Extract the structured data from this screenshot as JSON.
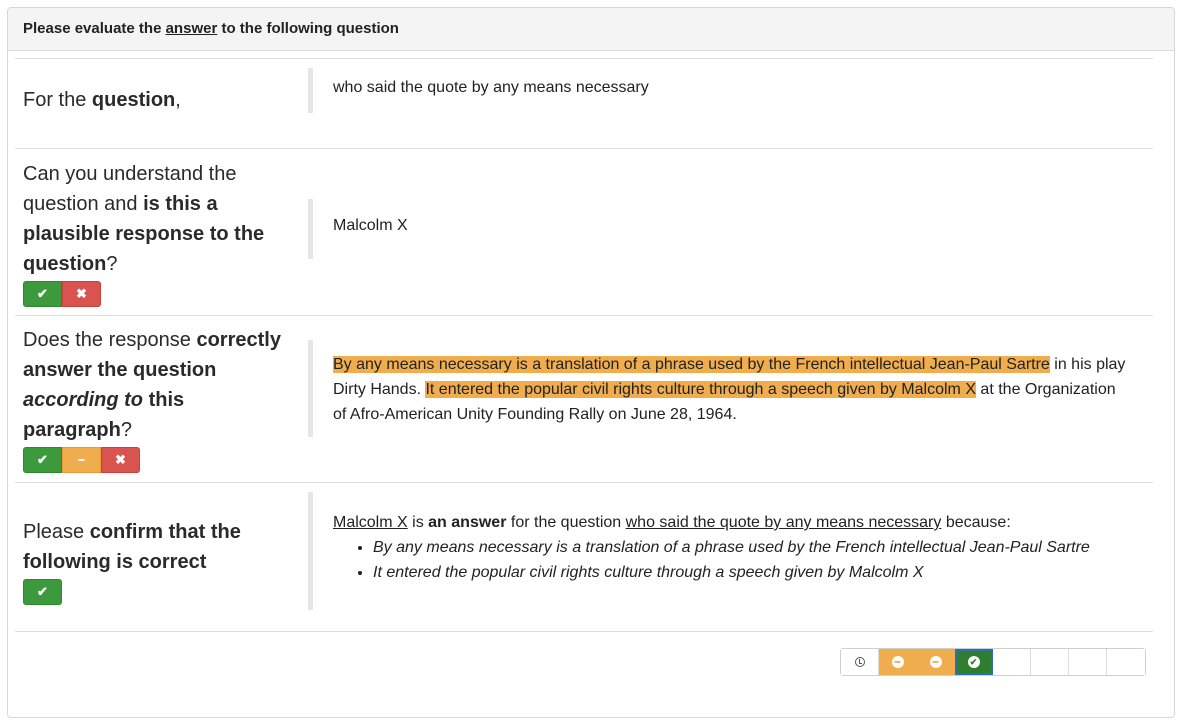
{
  "header": {
    "prefix": "Please evaluate the",
    "keyword": "answer",
    "suffix": "to the following question"
  },
  "rows": {
    "question": {
      "label_pre": "For the",
      "label_bold": "question",
      "label_post": ",",
      "value": "who said the quote by any means necessary"
    },
    "plausible": {
      "label_pre": "Can you understand the question and",
      "label_bold": "is this a plausible response to the question",
      "label_post": "?",
      "value": "Malcolm X",
      "buttons": [
        {
          "icon": "check-icon",
          "glyph": "✔",
          "color": "#3c9a3c"
        },
        {
          "icon": "cross-icon",
          "glyph": "✖",
          "color": "#d9534f"
        }
      ]
    },
    "correct": {
      "label_pre": "Does the response",
      "label_bold": "correctly answer the question",
      "label_italic": "according to",
      "label_bold2": "this paragraph",
      "label_post": "?",
      "para": {
        "hl1": "By any means necessary is a translation of a phrase used by the French intellectual Jean-Paul Sartre",
        "plain1": " in his play Dirty Hands. ",
        "hl2": "It entered the popular civil rights culture through a speech given by Malcolm X",
        "plain2": " at the Organization of Afro-American Unity Founding Rally on June 28, 1964."
      },
      "buttons": [
        {
          "icon": "check-icon",
          "glyph": "✔",
          "color": "#3c9a3c"
        },
        {
          "icon": "minus-icon",
          "glyph": "━",
          "color": "#f0ad4e"
        },
        {
          "icon": "cross-icon",
          "glyph": "✖",
          "color": "#d9534f"
        }
      ]
    },
    "confirm": {
      "label_pre": "Please",
      "label_bold": "confirm that the following is correct",
      "summary": {
        "answer": "Malcolm X",
        "is": "is",
        "an_answer": "an answer",
        "for_q": "for the question",
        "question": "who said the quote by any means necessary",
        "because": "because:"
      },
      "reasons": [
        "By any means necessary is a translation of a phrase used by the French intellectual Jean-Paul Sartre",
        "It entered the popular civil rights culture through a speech given by Malcolm X"
      ],
      "button": {
        "icon": "check-icon",
        "glyph": "✔",
        "color": "#3c9a3c"
      }
    }
  },
  "pager": {
    "cells": [
      {
        "state": "pending",
        "icon": "clock-icon"
      },
      {
        "state": "partial",
        "icon": "minus-circle-icon",
        "glyph": "━"
      },
      {
        "state": "partial",
        "icon": "minus-circle-icon",
        "glyph": "━"
      },
      {
        "state": "done-active",
        "icon": "check-circle-icon",
        "glyph": "✔"
      },
      {
        "state": "empty"
      },
      {
        "state": "empty"
      },
      {
        "state": "empty"
      },
      {
        "state": "empty"
      }
    ]
  }
}
